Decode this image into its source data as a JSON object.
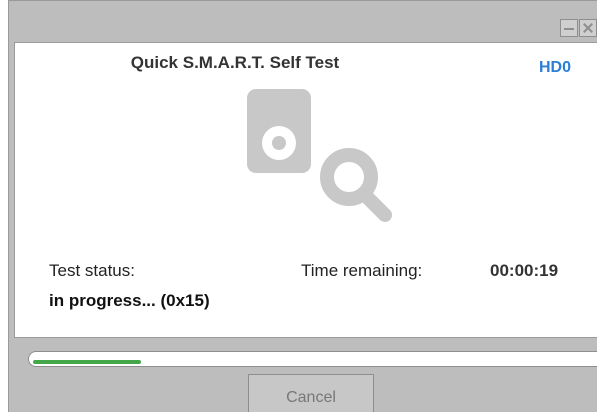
{
  "window": {
    "title": "Quick S.M.A.R.T. Self Test",
    "drive": "HD0"
  },
  "icons": {
    "main": "disk-search-icon",
    "minimize": "minimize-icon",
    "close": "close-icon"
  },
  "status": {
    "status_label": "Test status:",
    "status_value": "in progress...  (0x15)",
    "time_label": "Time remaining:",
    "time_value": "00:00:19"
  },
  "progress": {
    "fraction": 0.19
  },
  "buttons": {
    "cancel_label": "Cancel"
  },
  "colors": {
    "accent": "#2b7fd6",
    "progress": "#44a84a",
    "icon": "#c8c8c8"
  }
}
